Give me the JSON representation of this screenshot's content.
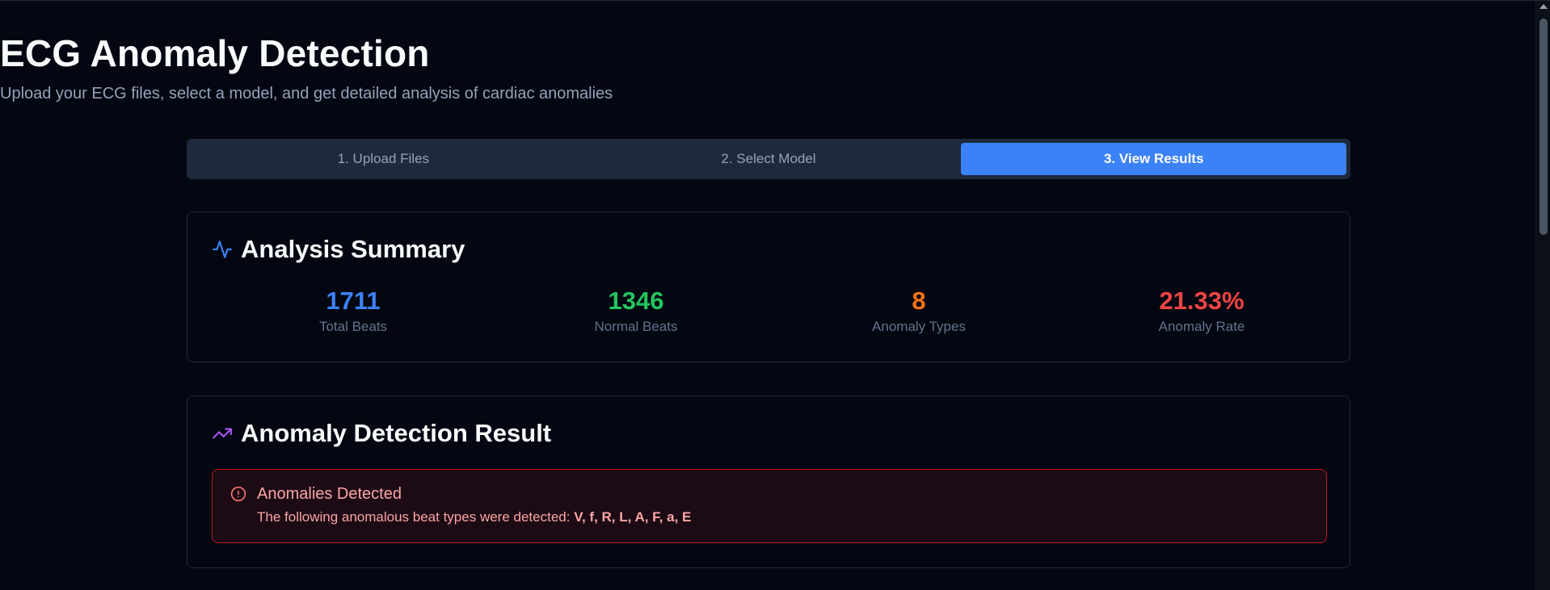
{
  "header": {
    "title": "ECG Anomaly Detection",
    "subtitle": "Upload your ECG files, select a model, and get detailed analysis of cardiac anomalies"
  },
  "tabs": [
    {
      "label": "1. Upload Files",
      "active": false
    },
    {
      "label": "2. Select Model",
      "active": false
    },
    {
      "label": "3. View Results",
      "active": true
    }
  ],
  "summary": {
    "title": "Analysis Summary",
    "icon": "activity-icon",
    "stats": [
      {
        "value": "1711",
        "label": "Total Beats",
        "color": "#3b82f6"
      },
      {
        "value": "1346",
        "label": "Normal Beats",
        "color": "#22c55e"
      },
      {
        "value": "8",
        "label": "Anomaly Types",
        "color": "#f97316"
      },
      {
        "value": "21.33%",
        "label": "Anomaly Rate",
        "color": "#ef4444"
      }
    ]
  },
  "result": {
    "title": "Anomaly Detection Result",
    "icon": "trending-up-icon",
    "alert": {
      "icon": "alert-circle-icon",
      "title": "Anomalies Detected",
      "text": "The following anomalous beat types were detected: ",
      "types": "V, f, R, L, A, F, a, E"
    }
  },
  "colors": {
    "background": "#030712",
    "accent": "#3b82f6",
    "alert": "#fca5a5"
  }
}
